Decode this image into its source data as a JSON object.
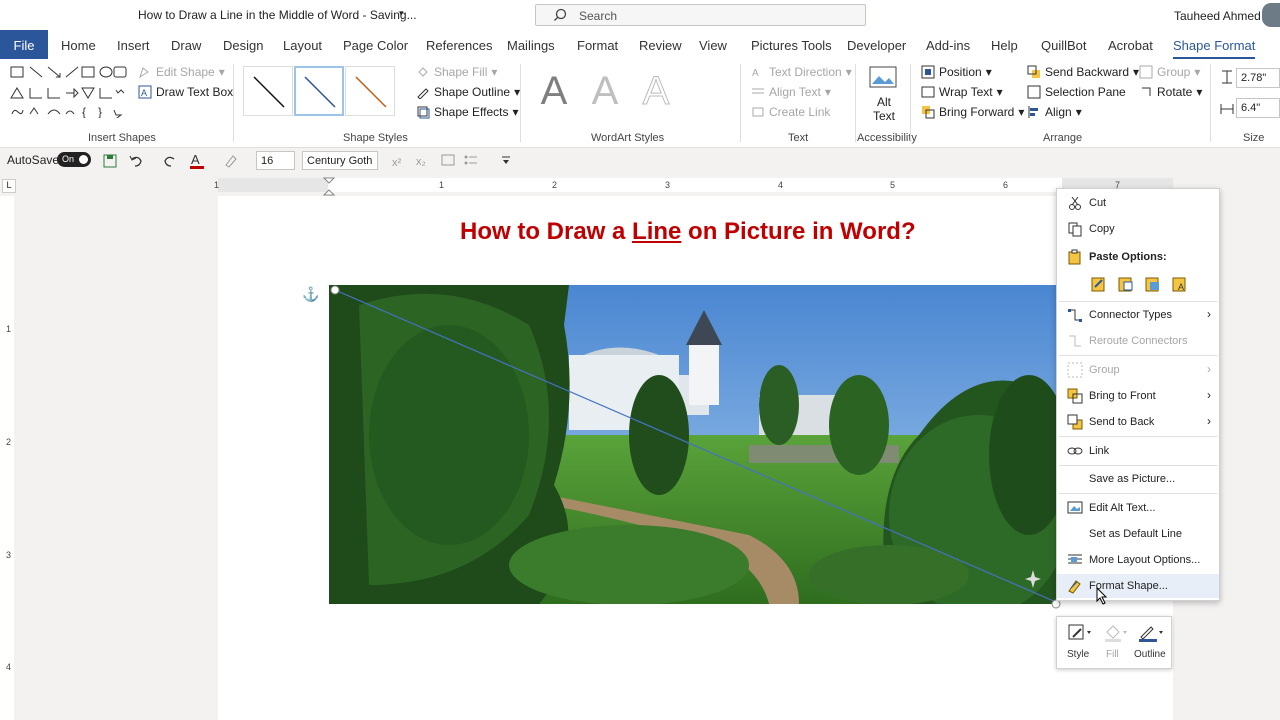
{
  "window": {
    "title": "How to Draw a Line in the Middle of Word  -  Saving...",
    "user": "Tauheed Ahmed"
  },
  "search": {
    "placeholder": "Search"
  },
  "tabs": [
    "File",
    "Home",
    "Insert",
    "Draw",
    "Design",
    "Layout",
    "Page Color",
    "References",
    "Mailings",
    "Format",
    "Review",
    "View",
    "Pictures Tools",
    "Developer",
    "Add-ins",
    "Help",
    "QuillBot",
    "Acrobat",
    "Shape Format"
  ],
  "ribbon": {
    "insert_shapes": {
      "edit_shape": "Edit Shape",
      "draw_text_box": "Draw Text Box",
      "label": "Insert Shapes"
    },
    "shape_styles": {
      "fill": "Shape Fill",
      "outline": "Shape Outline",
      "effects": "Shape Effects",
      "label": "Shape Styles"
    },
    "wordart": {
      "label": "WordArt Styles",
      "letter": "A"
    },
    "text": {
      "direction": "Text Direction",
      "align": "Align Text",
      "link": "Create Link",
      "label": "Text"
    },
    "accessibility": {
      "alt_text_1": "Alt",
      "alt_text_2": "Text",
      "label": "Accessibility"
    },
    "arrange": {
      "position": "Position",
      "wrap": "Wrap Text",
      "forward": "Bring Forward",
      "backward": "Send Backward",
      "selection": "Selection Pane",
      "align": "Align",
      "group": "Group",
      "rotate": "Rotate",
      "label": "Arrange"
    },
    "size": {
      "height": "2.78\"",
      "width": "6.4\"",
      "label": "Size"
    }
  },
  "qat": {
    "autosave": "AutoSave",
    "toggle": "On",
    "font_size": "16",
    "font_name": "Century Goth"
  },
  "ruler": {
    "h": [
      "1",
      "1",
      "2",
      "3",
      "4",
      "5",
      "6",
      "7"
    ],
    "v": [
      "1",
      "2",
      "3",
      "4"
    ]
  },
  "document": {
    "heading_pre": "How to Draw a ",
    "heading_link": "Line",
    "heading_post": " on Picture in Word?"
  },
  "context_menu": {
    "cut": "Cut",
    "copy": "Copy",
    "paste_options": "Paste Options:",
    "connector_types": "Connector Types",
    "reroute": "Reroute Connectors",
    "group": "Group",
    "bring_front": "Bring to Front",
    "send_back": "Send to Back",
    "link": "Link",
    "save_picture": "Save as Picture...",
    "edit_alt": "Edit Alt Text...",
    "default_line": "Set as Default Line",
    "more_layout": "More Layout Options...",
    "format_shape": "Format Shape..."
  },
  "mini_toolbar": {
    "style": "Style",
    "fill": "Fill",
    "outline": "Outline"
  },
  "colors": {
    "accent": "#2b579a",
    "heading": "#c00000",
    "font_color_bar": "#c00000"
  }
}
